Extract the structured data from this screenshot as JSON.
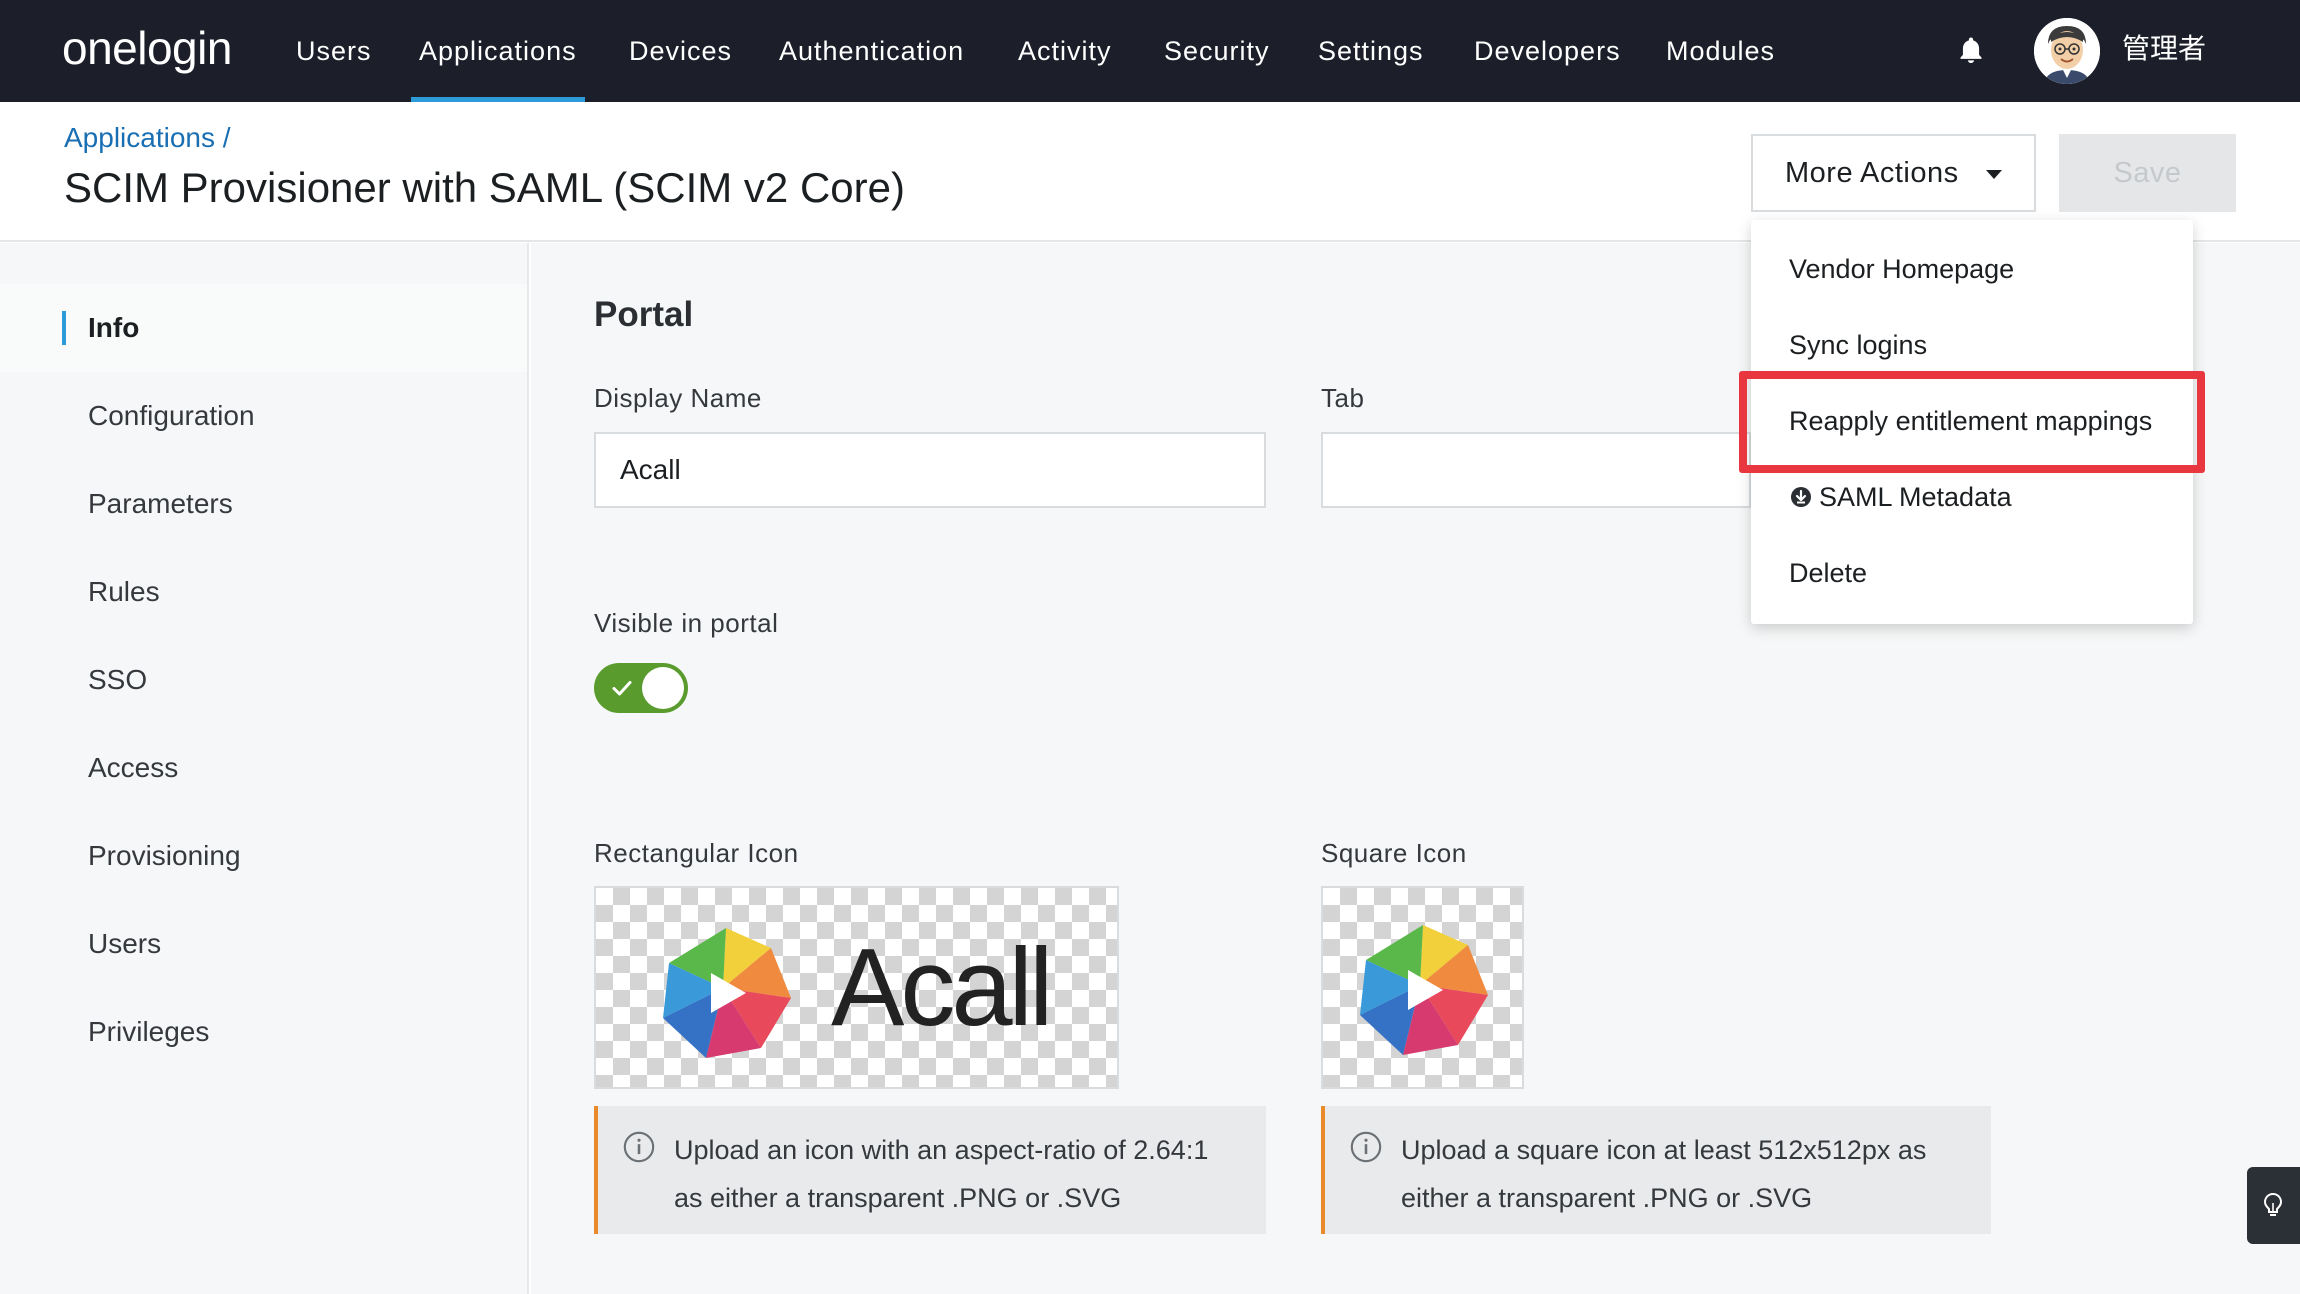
{
  "topnav": {
    "logo": "onelogin",
    "items": [
      {
        "label": "Users",
        "active": false
      },
      {
        "label": "Applications",
        "active": true
      },
      {
        "label": "Devices",
        "active": false
      },
      {
        "label": "Authentication",
        "active": false
      },
      {
        "label": "Activity",
        "active": false
      },
      {
        "label": "Security",
        "active": false
      },
      {
        "label": "Settings",
        "active": false
      },
      {
        "label": "Developers",
        "active": false
      },
      {
        "label": "Modules",
        "active": false
      }
    ],
    "username": "管理者",
    "icons": {
      "notifications": "bell-icon",
      "avatar": "user-avatar"
    }
  },
  "header": {
    "breadcrumb": "Applications /",
    "title": "SCIM Provisioner with SAML (SCIM v2 Core)",
    "more_actions_label": "More Actions",
    "save_label": "Save"
  },
  "dropdown": {
    "items": [
      {
        "label": "Vendor Homepage"
      },
      {
        "label": "Sync logins"
      },
      {
        "label": "Reapply entitlement mappings",
        "highlighted": true
      },
      {
        "label": "SAML Metadata",
        "icon": "download-icon"
      },
      {
        "label": "Delete"
      }
    ],
    "highlight_color": "#e8373f"
  },
  "sidebar": {
    "items": [
      {
        "label": "Info",
        "active": true
      },
      {
        "label": "Configuration"
      },
      {
        "label": "Parameters"
      },
      {
        "label": "Rules"
      },
      {
        "label": "SSO"
      },
      {
        "label": "Access"
      },
      {
        "label": "Provisioning"
      },
      {
        "label": "Users"
      },
      {
        "label": "Privileges"
      }
    ]
  },
  "portal": {
    "section_title": "Portal",
    "display_name_label": "Display Name",
    "display_name_value": "Acall",
    "tab_label": "Tab",
    "tab_value": "",
    "visible_label": "Visible in portal",
    "visible": true,
    "rect_icon_label": "Rectangular Icon",
    "rect_icon_logo_text": "Acall",
    "square_icon_label": "Square Icon",
    "rect_hint": "Upload an icon with an aspect-ratio of 2.64:1 as either a transparent .PNG or .SVG",
    "square_hint": "Upload a square icon at least 512x512px as either a transparent .PNG or .SVG"
  },
  "colors": {
    "nav_bg": "#1c1f2a",
    "accent": "#2d9bd8",
    "toggle_on": "#5a9b2e",
    "hint_border": "#e98b2a",
    "link": "#1a6fb3"
  }
}
